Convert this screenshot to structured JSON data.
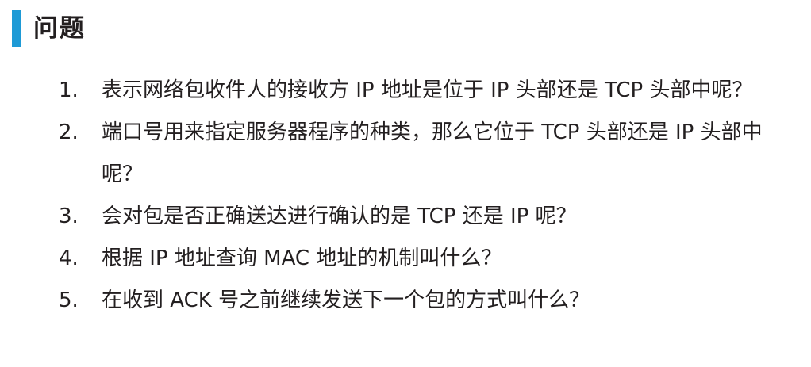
{
  "heading": {
    "title": "问题",
    "accent_color": "#1e9ad6"
  },
  "questions": [
    {
      "number": "1.",
      "text": "表示网络包收件人的接收方 IP 地址是位于 IP 头部还是 TCP 头部中呢？"
    },
    {
      "number": "2.",
      "text": "端口号用来指定服务器程序的种类，那么它位于 TCP 头部还是 IP 头部中呢？"
    },
    {
      "number": "3.",
      "text": "会对包是否正确送达进行确认的是 TCP 还是 IP 呢？"
    },
    {
      "number": "4.",
      "text": "根据 IP 地址查询 MAC 地址的机制叫什么？"
    },
    {
      "number": "5.",
      "text": "在收到 ACK 号之前继续发送下一个包的方式叫什么？"
    }
  ]
}
